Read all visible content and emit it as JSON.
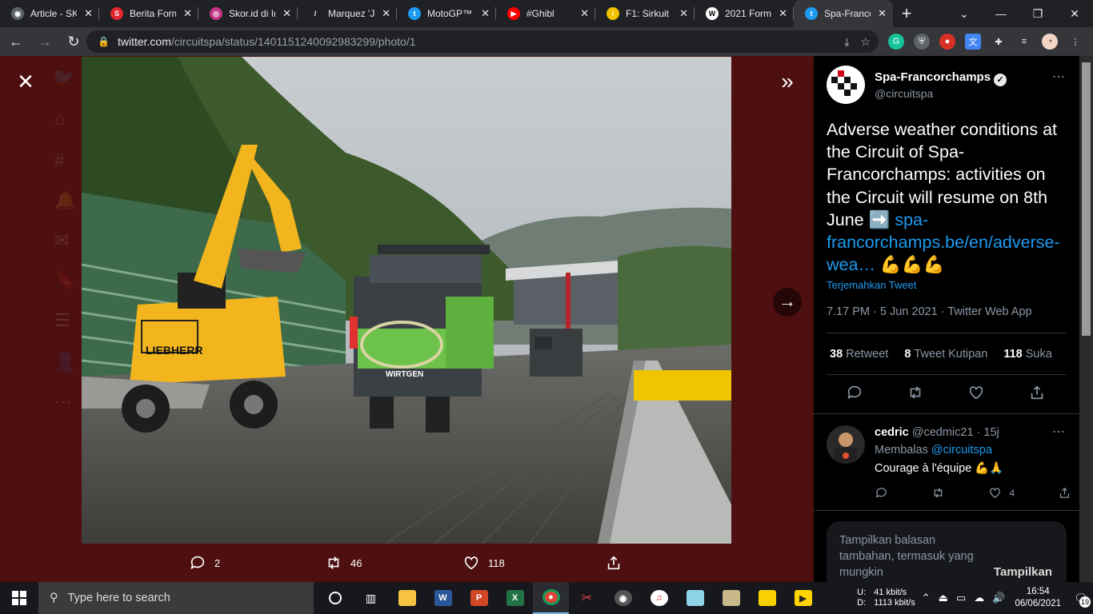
{
  "browser": {
    "tabs": [
      {
        "title": "Article - SK",
        "fav_color": "#5f6368",
        "fav_glyph": "◉",
        "icon": "globe-icon"
      },
      {
        "title": "Berita Form",
        "fav_color": "#e3262e",
        "fav_glyph": "S",
        "icon": "sport-site-icon"
      },
      {
        "title": "Skor.id di In",
        "fav_color": "#c13584",
        "fav_glyph": "◎",
        "icon": "instagram-icon"
      },
      {
        "title": "Marquez 'Ju",
        "fav_color": "#202124",
        "fav_glyph": "/",
        "icon": "crash-site-icon"
      },
      {
        "title": "MotoGP™ R",
        "fav_color": "#1d9bf0",
        "fav_glyph": "t",
        "icon": "twitter-icon"
      },
      {
        "title": "#Ghibl",
        "fav_color": "#ff0000",
        "fav_glyph": "▶",
        "icon": "youtube-icon"
      },
      {
        "title": "F1: Sirkuit S",
        "fav_color": "#f4c300",
        "fav_glyph": "/",
        "icon": "site-icon"
      },
      {
        "title": "2021 Formu",
        "fav_color": "#ffffff",
        "fav_glyph": "W",
        "icon": "wikipedia-icon"
      },
      {
        "title": "Spa-Francor",
        "fav_color": "#1d9bf0",
        "fav_glyph": "t",
        "icon": "twitter-icon",
        "active": true
      }
    ],
    "url_host": "twitter.com",
    "url_path": "/circuitspa/status/1401151240092983299/photo/1"
  },
  "viewer": {
    "reply_count": "2",
    "retweet_count": "46",
    "like_count": "118"
  },
  "tweet": {
    "display_name": "Spa-Francorchamps",
    "handle": "@circuitspa",
    "text_main": "Adverse weather conditions at the Circuit of Spa-Francorchamps: activities on the Circuit will resume on 8th June ➡️ ",
    "text_link": "spa-francorchamps.be/en/adverse-wea…",
    "text_emoji": " 💪💪💪",
    "translate": "Terjemahkan Tweet",
    "meta": "7.17 PM · 5 Jun 2021 · Twitter Web App",
    "retweets_num": "38",
    "retweets_label": "Retweet",
    "quotes_num": "8",
    "quotes_label": "Tweet Kutipan",
    "likes_num": "118",
    "likes_label": "Suka"
  },
  "reply": {
    "name": "cedric",
    "handle_time": "@cedmic21 · 15j",
    "replying_prefix": "Membalas ",
    "replying_to": "@circuitspa",
    "text": "Courage à l'équipe 💪🙏",
    "like_count": "4"
  },
  "more_replies": {
    "text": "Tampilkan balasan tambahan, termasuk yang mungkin",
    "button": "Tampilkan"
  },
  "taskbar": {
    "search_placeholder": "Type here to search",
    "net_up_label": "U:",
    "net_up": "41 kbit/s",
    "net_down_label": "D:",
    "net_down": "1113 kbit/s",
    "time": "16:54",
    "date": "06/06/2021",
    "notif_count": "19"
  }
}
